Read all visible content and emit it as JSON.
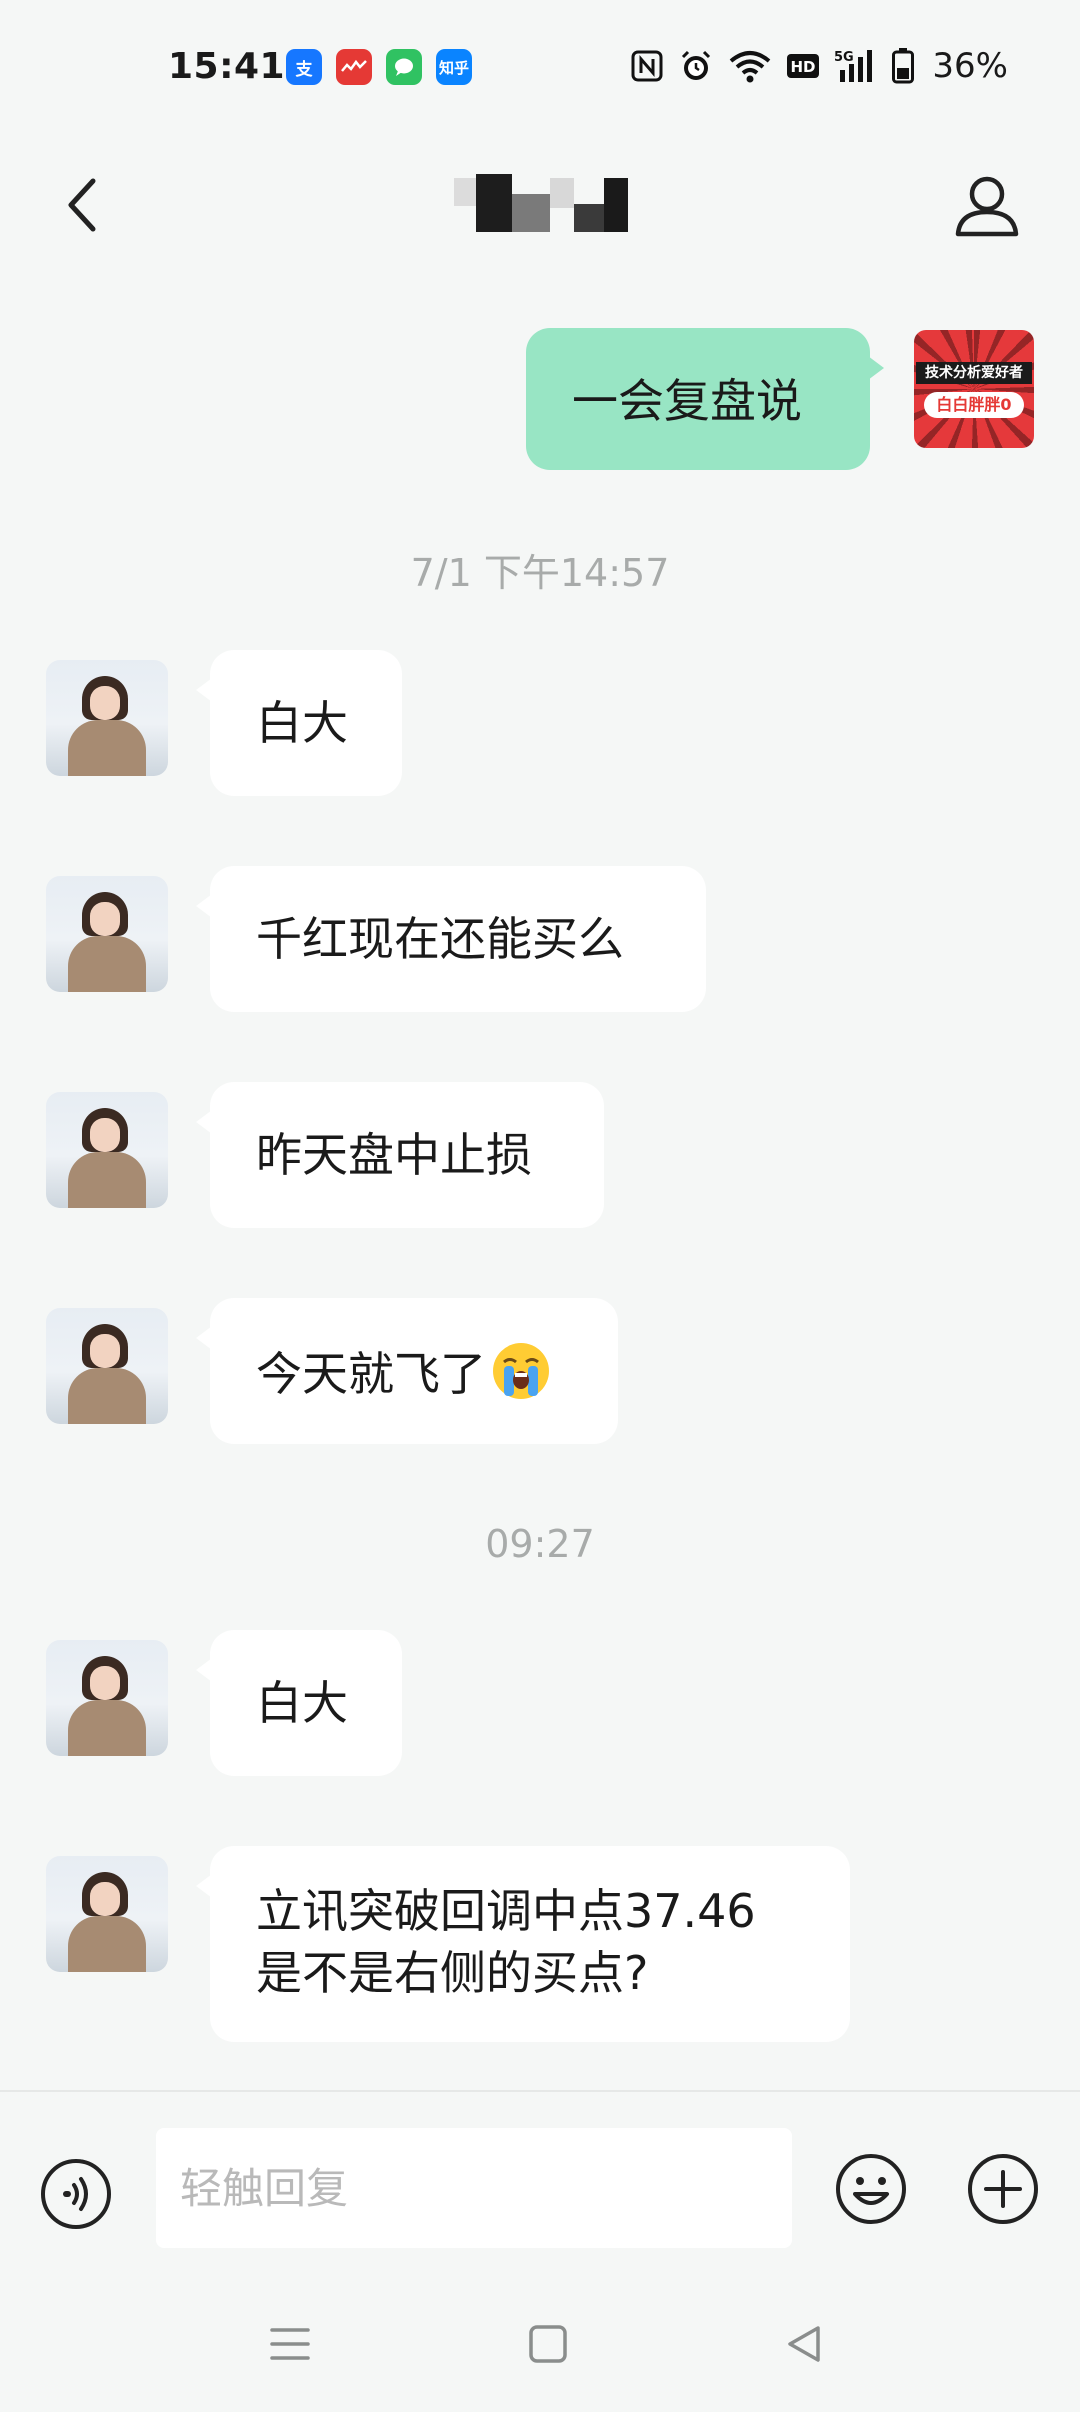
{
  "status_bar": {
    "time": "15:41",
    "badges": [
      {
        "icon": "alipay-icon",
        "label": "支"
      },
      {
        "icon": "red-app-icon",
        "label": "~~"
      },
      {
        "icon": "message-app-icon",
        "label": ""
      },
      {
        "icon": "zhihu-icon",
        "label": "知乎"
      }
    ],
    "network": "5G",
    "hd": "HD",
    "battery": "36%"
  },
  "header": {
    "back_icon": "chevron-left-icon",
    "profile_icon": "person-icon"
  },
  "messages": [
    {
      "from": "me",
      "text": "一会复盘说"
    },
    {
      "type": "timestamp",
      "text": "7/1 下午14:57"
    },
    {
      "from": "them",
      "text": "白大"
    },
    {
      "from": "them",
      "text": "千红现在还能买么"
    },
    {
      "from": "them",
      "text": "昨天盘中止损"
    },
    {
      "from": "them",
      "text": "今天就飞了",
      "emoji": "loudly-crying-face"
    },
    {
      "type": "timestamp",
      "text": "09:27"
    },
    {
      "from": "them",
      "text": "白大"
    },
    {
      "from": "them",
      "text_line1": "立讯突破回调中点37.46",
      "text_line2": "是不是右侧的买点?"
    }
  ],
  "my_avatar": {
    "top_text": "技术分析爱好者",
    "bottom_text": "白白胖胖0"
  },
  "input": {
    "placeholder": "轻触回复"
  },
  "colors": {
    "background": "#f5f7f6",
    "my_bubble": "#98e5c4",
    "their_bubble": "#ffffff",
    "timestamp": "#a8abaa"
  }
}
